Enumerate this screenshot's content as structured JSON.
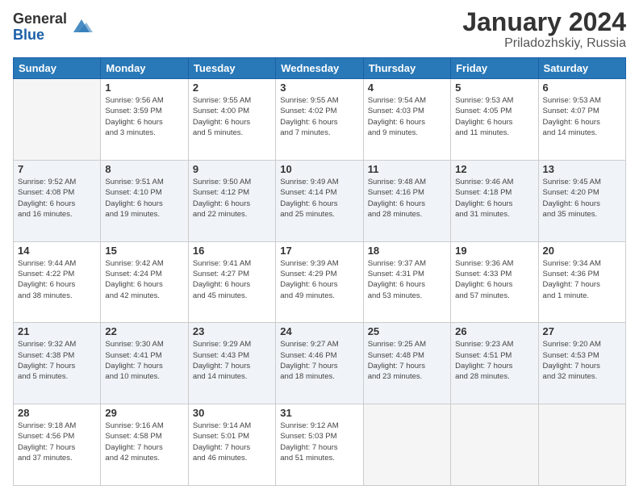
{
  "header": {
    "logo_general": "General",
    "logo_blue": "Blue",
    "title": "January 2024",
    "subtitle": "Priladozhskiy, Russia"
  },
  "weekdays": [
    "Sunday",
    "Monday",
    "Tuesday",
    "Wednesday",
    "Thursday",
    "Friday",
    "Saturday"
  ],
  "weeks": [
    [
      {
        "day": "",
        "info": ""
      },
      {
        "day": "1",
        "info": "Sunrise: 9:56 AM\nSunset: 3:59 PM\nDaylight: 6 hours\nand 3 minutes."
      },
      {
        "day": "2",
        "info": "Sunrise: 9:55 AM\nSunset: 4:00 PM\nDaylight: 6 hours\nand 5 minutes."
      },
      {
        "day": "3",
        "info": "Sunrise: 9:55 AM\nSunset: 4:02 PM\nDaylight: 6 hours\nand 7 minutes."
      },
      {
        "day": "4",
        "info": "Sunrise: 9:54 AM\nSunset: 4:03 PM\nDaylight: 6 hours\nand 9 minutes."
      },
      {
        "day": "5",
        "info": "Sunrise: 9:53 AM\nSunset: 4:05 PM\nDaylight: 6 hours\nand 11 minutes."
      },
      {
        "day": "6",
        "info": "Sunrise: 9:53 AM\nSunset: 4:07 PM\nDaylight: 6 hours\nand 14 minutes."
      }
    ],
    [
      {
        "day": "7",
        "info": "Sunrise: 9:52 AM\nSunset: 4:08 PM\nDaylight: 6 hours\nand 16 minutes."
      },
      {
        "day": "8",
        "info": "Sunrise: 9:51 AM\nSunset: 4:10 PM\nDaylight: 6 hours\nand 19 minutes."
      },
      {
        "day": "9",
        "info": "Sunrise: 9:50 AM\nSunset: 4:12 PM\nDaylight: 6 hours\nand 22 minutes."
      },
      {
        "day": "10",
        "info": "Sunrise: 9:49 AM\nSunset: 4:14 PM\nDaylight: 6 hours\nand 25 minutes."
      },
      {
        "day": "11",
        "info": "Sunrise: 9:48 AM\nSunset: 4:16 PM\nDaylight: 6 hours\nand 28 minutes."
      },
      {
        "day": "12",
        "info": "Sunrise: 9:46 AM\nSunset: 4:18 PM\nDaylight: 6 hours\nand 31 minutes."
      },
      {
        "day": "13",
        "info": "Sunrise: 9:45 AM\nSunset: 4:20 PM\nDaylight: 6 hours\nand 35 minutes."
      }
    ],
    [
      {
        "day": "14",
        "info": "Sunrise: 9:44 AM\nSunset: 4:22 PM\nDaylight: 6 hours\nand 38 minutes."
      },
      {
        "day": "15",
        "info": "Sunrise: 9:42 AM\nSunset: 4:24 PM\nDaylight: 6 hours\nand 42 minutes."
      },
      {
        "day": "16",
        "info": "Sunrise: 9:41 AM\nSunset: 4:27 PM\nDaylight: 6 hours\nand 45 minutes."
      },
      {
        "day": "17",
        "info": "Sunrise: 9:39 AM\nSunset: 4:29 PM\nDaylight: 6 hours\nand 49 minutes."
      },
      {
        "day": "18",
        "info": "Sunrise: 9:37 AM\nSunset: 4:31 PM\nDaylight: 6 hours\nand 53 minutes."
      },
      {
        "day": "19",
        "info": "Sunrise: 9:36 AM\nSunset: 4:33 PM\nDaylight: 6 hours\nand 57 minutes."
      },
      {
        "day": "20",
        "info": "Sunrise: 9:34 AM\nSunset: 4:36 PM\nDaylight: 7 hours\nand 1 minute."
      }
    ],
    [
      {
        "day": "21",
        "info": "Sunrise: 9:32 AM\nSunset: 4:38 PM\nDaylight: 7 hours\nand 5 minutes."
      },
      {
        "day": "22",
        "info": "Sunrise: 9:30 AM\nSunset: 4:41 PM\nDaylight: 7 hours\nand 10 minutes."
      },
      {
        "day": "23",
        "info": "Sunrise: 9:29 AM\nSunset: 4:43 PM\nDaylight: 7 hours\nand 14 minutes."
      },
      {
        "day": "24",
        "info": "Sunrise: 9:27 AM\nSunset: 4:46 PM\nDaylight: 7 hours\nand 18 minutes."
      },
      {
        "day": "25",
        "info": "Sunrise: 9:25 AM\nSunset: 4:48 PM\nDaylight: 7 hours\nand 23 minutes."
      },
      {
        "day": "26",
        "info": "Sunrise: 9:23 AM\nSunset: 4:51 PM\nDaylight: 7 hours\nand 28 minutes."
      },
      {
        "day": "27",
        "info": "Sunrise: 9:20 AM\nSunset: 4:53 PM\nDaylight: 7 hours\nand 32 minutes."
      }
    ],
    [
      {
        "day": "28",
        "info": "Sunrise: 9:18 AM\nSunset: 4:56 PM\nDaylight: 7 hours\nand 37 minutes."
      },
      {
        "day": "29",
        "info": "Sunrise: 9:16 AM\nSunset: 4:58 PM\nDaylight: 7 hours\nand 42 minutes."
      },
      {
        "day": "30",
        "info": "Sunrise: 9:14 AM\nSunset: 5:01 PM\nDaylight: 7 hours\nand 46 minutes."
      },
      {
        "day": "31",
        "info": "Sunrise: 9:12 AM\nSunset: 5:03 PM\nDaylight: 7 hours\nand 51 minutes."
      },
      {
        "day": "",
        "info": ""
      },
      {
        "day": "",
        "info": ""
      },
      {
        "day": "",
        "info": ""
      }
    ]
  ]
}
